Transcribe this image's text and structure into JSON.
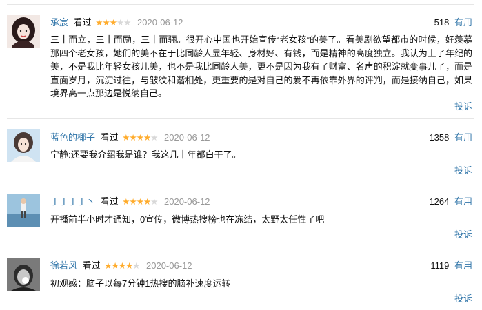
{
  "reviews": [
    {
      "author": "承宸",
      "watched_label": "看过",
      "rating": 3,
      "date": "2020-06-12",
      "votes": "518",
      "useful_label": "有用",
      "content": "三十而立，三十而励，三十而骊。很开心中国也开始宣传“老女孩”的美了。看美剧欲望都市的时候，好羡慕那四个老女孩，她们的美不在于比同龄人显年轻、身材好、有钱，而是精神的高度独立。我认为上了年纪的美，不是我比年轻女孩儿美，也不是我比同龄人美，更不是因为我有了财富、名声的积淀就变事儿了，而是直面岁月，沉淀过往，与皱纹和谐相处，更重要的是对自己的爱不再依靠外界的评判，而是接纳自己，如果境界高一点那边是悦纳自己。",
      "report_label": "投诉"
    },
    {
      "author": "蓝色的椰子",
      "watched_label": "看过",
      "rating": 4,
      "date": "2020-06-12",
      "votes": "1358",
      "useful_label": "有用",
      "content": "宁静:还要我介绍我是谁？我这几十年都白干了。",
      "report_label": "投诉"
    },
    {
      "author": "丁丁丁丁丶",
      "watched_label": "看过",
      "rating": 4,
      "date": "2020-06-12",
      "votes": "1264",
      "useful_label": "有用",
      "content": "开播前半小时才通知，0宣传，微博热搜榜也在冻结，太野太任性了吧",
      "report_label": "投诉"
    },
    {
      "author": "徐若风",
      "watched_label": "看过",
      "rating": 4,
      "date": "2020-06-12",
      "votes": "1119",
      "useful_label": "有用",
      "content": "初观感：脑子以每7分钟1热搜的脑补速度运转",
      "report_label": "投诉"
    }
  ],
  "star_on_color": "#ffac2d",
  "star_off_color": "#d8d8d8",
  "link_color": "#3377aa"
}
